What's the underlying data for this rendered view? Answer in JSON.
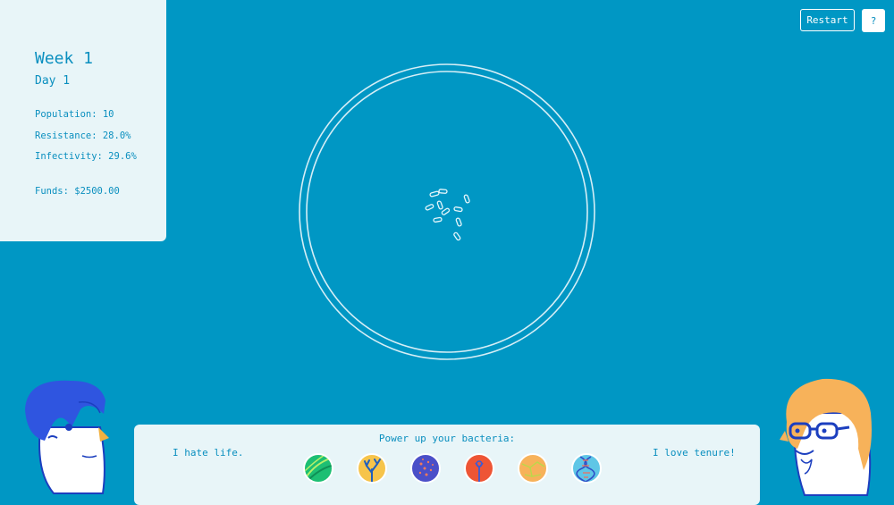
{
  "stats": {
    "week": "Week 1",
    "day": "Day 1",
    "population": "Population: 10",
    "resistance": "Resistance: 28.0%",
    "infectivity": "Infectivity: 29.6%",
    "funds": "Funds: $2500.00"
  },
  "controls": {
    "restart_label": "Restart",
    "help_label": "?"
  },
  "bottom": {
    "title": "Power up your bacteria:",
    "left_quote": "I hate life.",
    "right_quote": "I love tenure!",
    "powerups": [
      {
        "icon": "green-bacteria-icon",
        "color": "#1dbf73"
      },
      {
        "icon": "coral-icon",
        "color": "#f6c44b"
      },
      {
        "icon": "purple-cells-icon",
        "color": "#4b4fc8"
      },
      {
        "icon": "red-virus-icon",
        "color": "#ee5535"
      },
      {
        "icon": "orange-network-icon",
        "color": "#f7b25a"
      },
      {
        "icon": "dna-icon",
        "color": "#5fc6e6"
      }
    ]
  },
  "colors": {
    "background": "#0097c4",
    "panel": "#e8f5f8",
    "text": "#0a8fbf"
  }
}
